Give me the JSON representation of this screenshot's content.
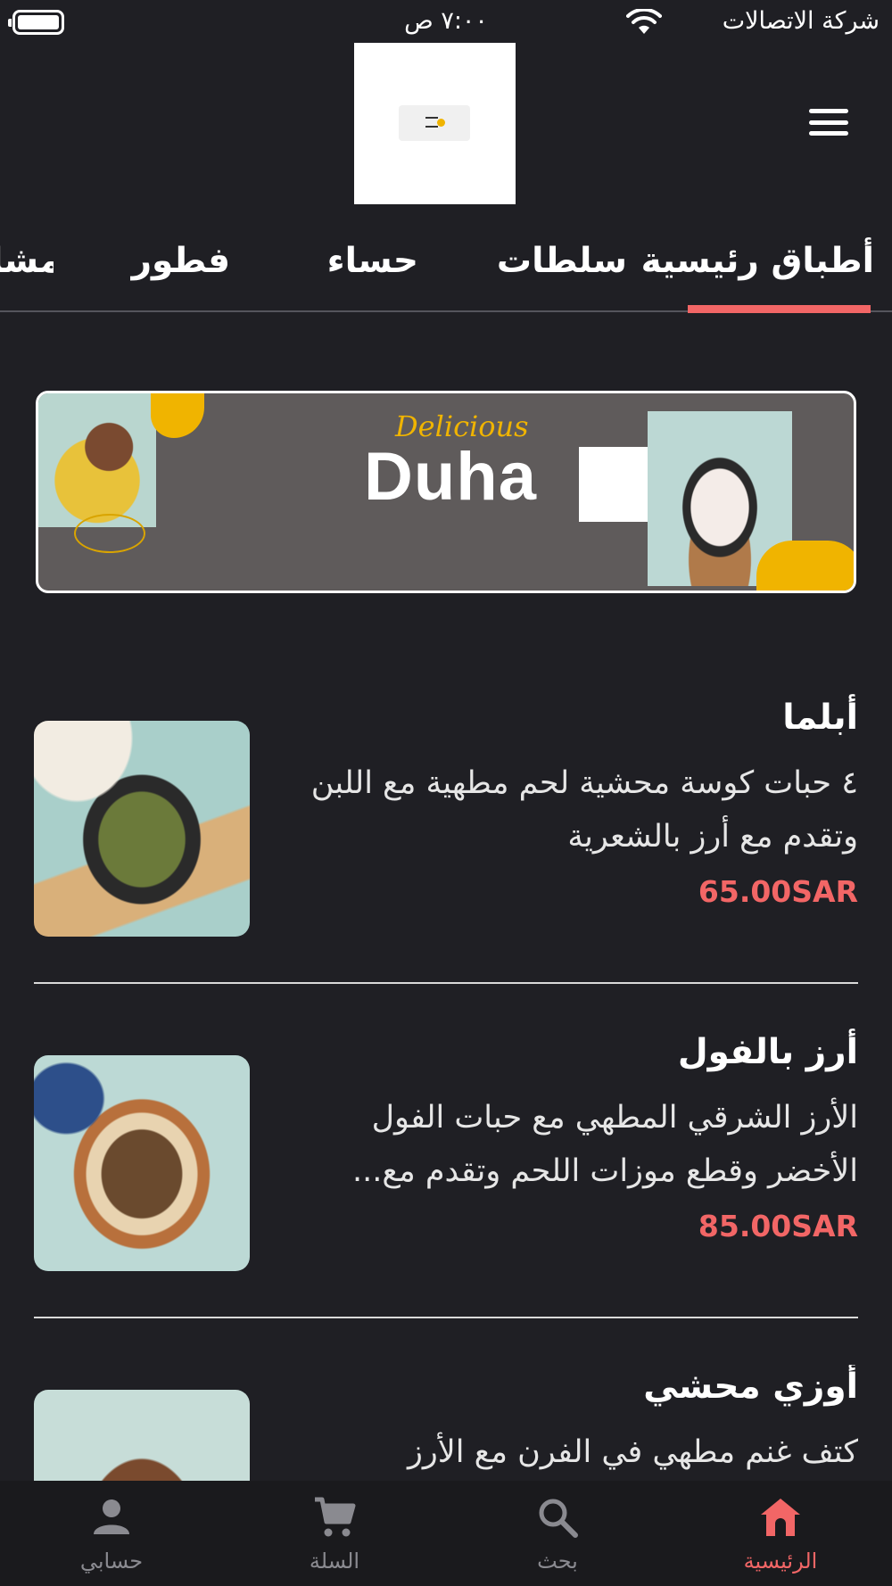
{
  "status_bar": {
    "time": "٧:٠٠ ص",
    "carrier": "شركة الاتصالات",
    "icons": [
      "battery-icon",
      "wifi-icon"
    ]
  },
  "header": {
    "logo_alt": "Duha logo",
    "menu_icon": "hamburger-menu-icon"
  },
  "tabs": [
    {
      "label": "أطباق رئيسية",
      "active": true
    },
    {
      "label": "سلطات",
      "active": false
    },
    {
      "label": "حساء",
      "active": false
    },
    {
      "label": "فطور",
      "active": false
    },
    {
      "label": "مشا",
      "active": false
    }
  ],
  "banner": {
    "script_text": "Delicious",
    "title": "Duha"
  },
  "products": [
    {
      "name": "أبلما",
      "description": "٤ حبات كوسة محشية لحم مطهية مع اللبن وتقدم مع أرز بالشعرية",
      "price": "65.00SAR"
    },
    {
      "name": "أرز بالفول",
      "description": "الأرز الشرقي المطهي مع حبات الفول الأخضر وقطع موزات اللحم وتقدم مع...",
      "price": "85.00SAR"
    },
    {
      "name": "أوزي محشي",
      "description": "كتف غنم مطهي في الفرن مع الأرز",
      "price": ""
    }
  ],
  "bottom_nav": [
    {
      "label": "الرئيسية",
      "icon": "home-icon",
      "active": true
    },
    {
      "label": "بحث",
      "icon": "search-icon",
      "active": false
    },
    {
      "label": "السلة",
      "icon": "cart-icon",
      "active": false
    },
    {
      "label": "حسابي",
      "icon": "account-icon",
      "active": false
    }
  ],
  "colors": {
    "background": "#1f1f24",
    "accent": "#f26666",
    "banner_bg": "#5f5b5b",
    "banner_accent": "#f0b400",
    "nav_inactive": "#8a8a90"
  }
}
